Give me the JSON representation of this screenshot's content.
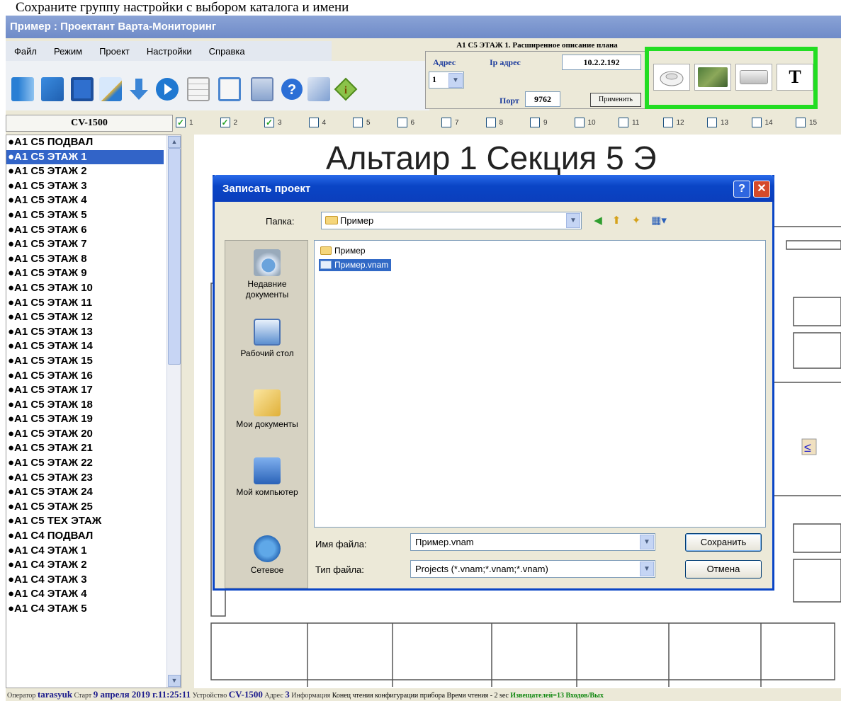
{
  "intro_text": "Сохраните группу настройки с выбором каталога и имени",
  "window": {
    "title": "Пример : Проектант Варта-Мониторинг"
  },
  "menu": [
    "Файл",
    "Режим",
    "Проект",
    "Настройки",
    "Справка"
  ],
  "plan_description": "А1 С5 ЭТАЖ 1. Расширенное описание плана",
  "address_panel": {
    "address_label": "Адрес",
    "address_value": "1",
    "ip_label": "Ip адрес",
    "ip_value": "10.2.2.192",
    "port_label": "Порт",
    "port_value": "9762",
    "apply_label": "Применить"
  },
  "device_panel": {
    "text_tool_label": "T"
  },
  "device_label": "CV-1500",
  "channels": [
    {
      "label": "1",
      "checked": true
    },
    {
      "label": "2",
      "checked": true
    },
    {
      "label": "3",
      "checked": true
    },
    {
      "label": "4",
      "checked": false
    },
    {
      "label": "5",
      "checked": false
    },
    {
      "label": "6",
      "checked": false
    },
    {
      "label": "7",
      "checked": false
    },
    {
      "label": "8",
      "checked": false
    },
    {
      "label": "9",
      "checked": false
    },
    {
      "label": "10",
      "checked": false
    },
    {
      "label": "11",
      "checked": false
    },
    {
      "label": "12",
      "checked": false
    },
    {
      "label": "13",
      "checked": false
    },
    {
      "label": "14",
      "checked": false
    },
    {
      "label": "15",
      "checked": false
    }
  ],
  "floors": [
    "●А1 С5 ПОДВАЛ",
    "●А1 С5 ЭТАЖ 1",
    "●А1 С5 ЭТАЖ 2",
    "●А1 С5 ЭТАЖ 3",
    "●А1 С5 ЭТАЖ 4",
    "●А1 С5 ЭТАЖ 5",
    "●А1 С5 ЭТАЖ 6",
    "●А1 С5 ЭТАЖ 7",
    "●А1 С5 ЭТАЖ 8",
    "●А1 С5 ЭТАЖ 9",
    "●А1 С5 ЭТАЖ 10",
    "●А1 С5 ЭТАЖ 11",
    "●А1 С5 ЭТАЖ 12",
    "●А1 С5 ЭТАЖ 13",
    "●А1 С5 ЭТАЖ 14",
    "●А1 С5 ЭТАЖ 15",
    "●А1 С5 ЭТАЖ 16",
    "●А1 С5 ЭТАЖ 17",
    "●А1 С5 ЭТАЖ 18",
    "●А1 С5 ЭТАЖ 19",
    "●А1 С5 ЭТАЖ 20",
    "●А1 С5 ЭТАЖ 21",
    "●А1 С5 ЭТАЖ 22",
    "●А1 С5 ЭТАЖ 23",
    "●А1 С5 ЭТАЖ 24",
    "●А1 С5 ЭТАЖ 25",
    "●А1 С5 ТЕХ ЭТАЖ",
    "●А1 С4 ПОДВАЛ",
    "●А1 С4 ЭТАЖ 1",
    "●А1 С4 ЭТАЖ 2",
    "●А1 С4 ЭТАЖ 3",
    "●А1 С4 ЭТАЖ 4",
    "●А1 С4 ЭТАЖ 5"
  ],
  "selected_floor_index": 1,
  "plan_title": "Альтаир 1 Секция 5 Э",
  "dialog": {
    "title": "Записать проект",
    "folder_label": "Папка:",
    "folder_value": "Пример",
    "places": [
      "Недавние документы",
      "Рабочий стол",
      "Мои документы",
      "Мой компьютер",
      "Сетевое"
    ],
    "files": [
      {
        "name": "Пример",
        "kind": "folder"
      },
      {
        "name": "Пример.vnam",
        "kind": "file"
      }
    ],
    "filename_label": "Имя файла:",
    "filename_value": "Пример.vnam",
    "filetype_label": "Тип файла:",
    "filetype_value": "Projects (*.vnam;*.vnam;*.vnam)",
    "save_label": "Сохранить",
    "cancel_label": "Отмена"
  },
  "status": {
    "operator_label": "Оператор",
    "operator_value": "tarasyuk",
    "start_label": "Старт",
    "start_value": "9 апреля 2019 г.11:25:11",
    "device_label": "Устройство",
    "device_value": "CV-1500",
    "address_label": "Адрес",
    "address_value": "3",
    "info_label": "Информация",
    "info_value": "Конец чтения конфигурации прибора Время чтения - 2 sec",
    "detectors": "Извещателей=13",
    "inputs": "Входов/Вых"
  },
  "colors": {
    "device_panel_border": "#22dd22",
    "dialog_frame": "#0a45c6",
    "selection": "#3264c8"
  }
}
